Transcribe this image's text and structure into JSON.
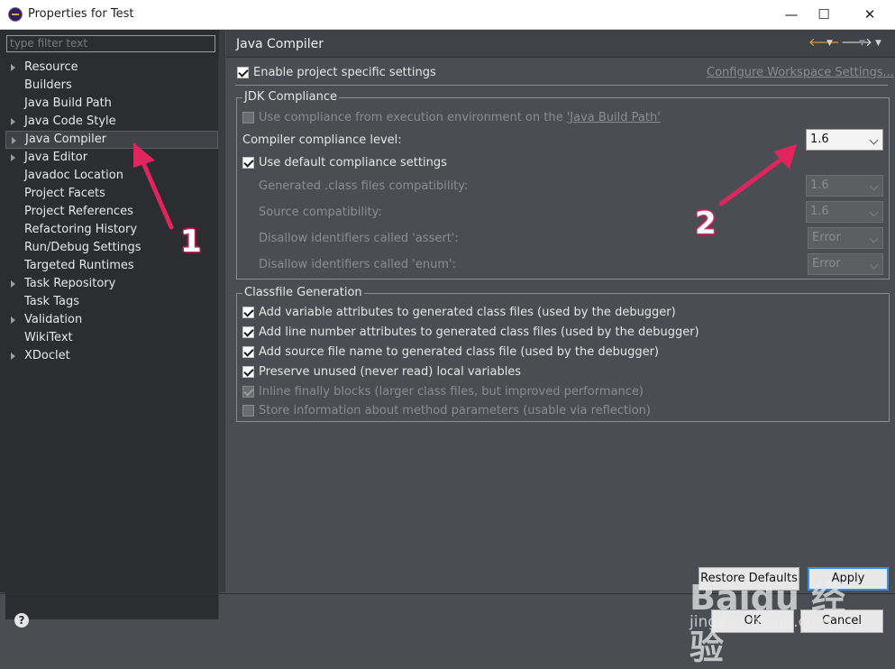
{
  "window": {
    "title": "Properties for Test",
    "minimize_glyph": "—",
    "maximize_glyph": "☐",
    "close_glyph": "✕"
  },
  "filter": {
    "placeholder": "type filter text"
  },
  "tree": {
    "items": [
      {
        "label": "Resource",
        "expandable": true
      },
      {
        "label": "Builders",
        "expandable": false
      },
      {
        "label": "Java Build Path",
        "expandable": false
      },
      {
        "label": "Java Code Style",
        "expandable": true
      },
      {
        "label": "Java Compiler",
        "expandable": true,
        "selected": true
      },
      {
        "label": "Java Editor",
        "expandable": true
      },
      {
        "label": "Javadoc Location",
        "expandable": false
      },
      {
        "label": "Project Facets",
        "expandable": false
      },
      {
        "label": "Project References",
        "expandable": false
      },
      {
        "label": "Refactoring History",
        "expandable": false
      },
      {
        "label": "Run/Debug Settings",
        "expandable": false
      },
      {
        "label": "Targeted Runtimes",
        "expandable": false
      },
      {
        "label": "Task Repository",
        "expandable": true
      },
      {
        "label": "Task Tags",
        "expandable": false
      },
      {
        "label": "Validation",
        "expandable": true
      },
      {
        "label": "WikiText",
        "expandable": false
      },
      {
        "label": "XDoclet",
        "expandable": true
      }
    ]
  },
  "page": {
    "title": "Java Compiler",
    "enable_specific": "Enable project specific settings",
    "configure_link": "Configure Workspace Settings...",
    "jdk": {
      "legend": "JDK Compliance",
      "use_env_prefix": "Use compliance from execution environment on the ",
      "use_env_link": "'Java Build Path'",
      "compliance_label": "Compiler compliance level:",
      "compliance_value": "1.6",
      "use_default": "Use default compliance settings",
      "generated_label": "Generated .class files compatibility:",
      "generated_value": "1.6",
      "source_label": "Source compatibility:",
      "source_value": "1.6",
      "assert_label": "Disallow identifiers called 'assert':",
      "assert_value": "Error",
      "enum_label": "Disallow identifiers called 'enum':",
      "enum_value": "Error"
    },
    "classfile": {
      "legend": "Classfile Generation",
      "opt1": "Add variable attributes to generated class files (used by the debugger)",
      "opt2": "Add line number attributes to generated class files (used by the debugger)",
      "opt3": "Add source file name to generated class file (used by the debugger)",
      "opt4": "Preserve unused (never read) local variables",
      "opt5": "Inline finally blocks (larger class files, but improved performance)",
      "opt6": "Store information about method parameters (usable via reflection)"
    }
  },
  "buttons": {
    "restore_defaults": "Restore Defaults",
    "apply": "Apply",
    "ok": "OK",
    "cancel": "Cancel",
    "help": "?"
  },
  "annotations": {
    "one": "1",
    "two": "2",
    "arrow_color": "#e0245e"
  },
  "watermark": {
    "logo": "Baidu 经验",
    "url": "jingyan.baidu.com"
  }
}
